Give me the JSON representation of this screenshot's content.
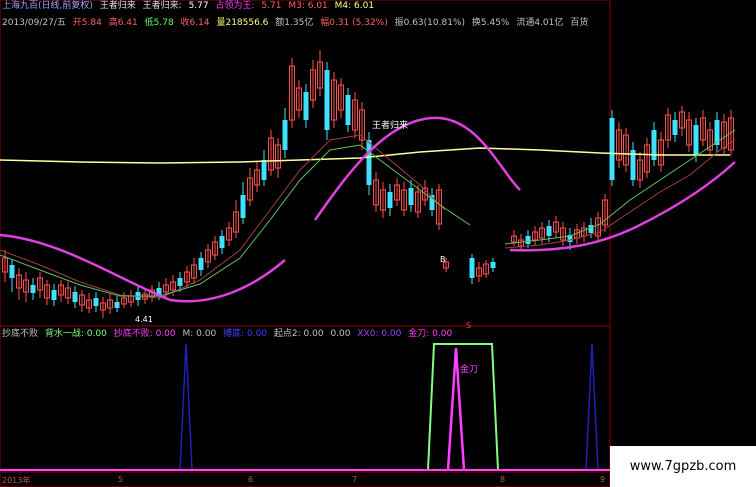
{
  "header_row1": {
    "stock": "上海九百(日线,前复权)",
    "ind_name": "王者归来",
    "ind_label": "王者归来:",
    "ind_val": "5.77",
    "zdw_label": "占领为王:",
    "zdw_val": "5.71",
    "m3": "M3: 6.01",
    "m4": "M4: 6.01"
  },
  "header_row2": {
    "date": "2013/09/27/五",
    "open": "开5.84",
    "high": "高6.41",
    "low": "低5.78",
    "close": "收6.14",
    "vol": "量218556.6",
    "amount": "额1.35亿",
    "change": "幅0.31 (5.32%)",
    "amplitude": "振0.63(10.81%)",
    "turnover": "换5.45%",
    "float": "流通4.01亿",
    "extra": "百货"
  },
  "header_row3": {
    "name": "抄底不败",
    "a": "背水一战: 0.00",
    "b": "抄底不败: 0.00",
    "c": "M: 0.00",
    "d": "搏底: 0.00",
    "e": "起点2: 0.00",
    "f": "0.00",
    "g": "XX0: 0.00",
    "h": "金刀: 0.00"
  },
  "chart_data": {
    "type": "candlestick",
    "title": "上海九百(日线,前复权)",
    "annotations": {
      "wangzhe": "王者归来",
      "low_price": "4.41",
      "jindao": "金刀",
      "marker": "S",
      "marker2": "B"
    },
    "x_ticks": [
      "2013年",
      "5",
      "6",
      "7",
      "8",
      "9"
    ],
    "watermark": "www.7gpzb.com",
    "colors": {
      "up": "#ff5050",
      "down": "#40e0ff",
      "ma_long": "#ffffa0",
      "wave": "#e040e0",
      "sub_green": "#80ff80",
      "sub_blue": "#2020c0",
      "sub_magenta": "#ff40ff"
    }
  }
}
